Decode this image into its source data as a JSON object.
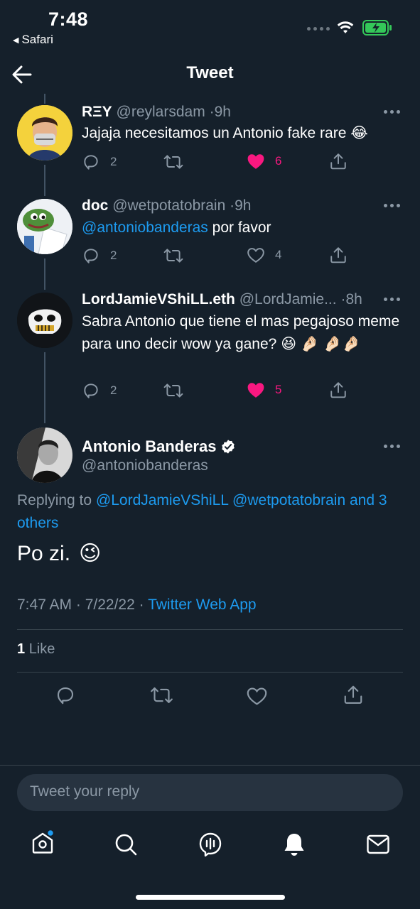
{
  "status_bar": {
    "time": "7:48",
    "back_app": "Safari"
  },
  "header": {
    "title": "Tweet"
  },
  "thread": [
    {
      "name": "RΞY",
      "handle": "@reylarsdam",
      "time": "9h",
      "text": "Jajaja necesitamos un Antonio fake rare",
      "text_emoji": "😂",
      "replies": "2",
      "likes": "6",
      "liked": true
    },
    {
      "name": "doc",
      "handle": "@wetpotatobrain",
      "time": "9h",
      "mention": "@antoniobanderas",
      "text": "por favor",
      "replies": "2",
      "likes": "4",
      "liked": false
    },
    {
      "name": "LordJamieVShiLL.eth",
      "handle": "@LordJamie...",
      "time": "8h",
      "text": "Sabra Antonio que tiene el mas pegajoso meme para uno decir wow ya gane?",
      "text_emoji": "😆 🤌🏻 🤌🏻🤌🏻",
      "replies": "2",
      "likes": "5",
      "liked": true
    }
  ],
  "main_tweet": {
    "name": "Antonio Banderas",
    "handle": "@antoniobanderas",
    "replying_prefix": "Replying to",
    "replying_users": "@LordJamieVShiLL @wetpotatobrain and 3 others",
    "text": "Po zi.",
    "text_emoji": "😉",
    "time": "7:47 AM · 7/22/22 ·",
    "source": "Twitter Web App",
    "like_count": "1",
    "like_label": "Like"
  },
  "reply": {
    "placeholder": "Tweet your reply"
  },
  "icons": [
    "back-arrow-icon",
    "reply-icon",
    "retweet-icon",
    "like-icon",
    "share-icon",
    "verified-icon",
    "home-icon",
    "search-icon",
    "spaces-icon",
    "notifications-icon",
    "messages-icon"
  ],
  "colors": {
    "background": "#15202b",
    "accent": "#1d9bf0",
    "like": "#f91880",
    "muted": "#8b98a5"
  }
}
